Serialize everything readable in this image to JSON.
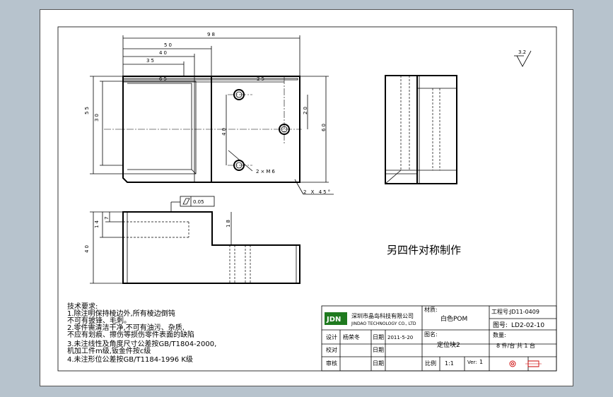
{
  "dimensions": {
    "d98": "98",
    "d50": "50",
    "d40": "40",
    "d35": "35",
    "d65": "65",
    "d25": "25",
    "d55": "55",
    "d30": "30",
    "d20": "20",
    "d60": "60",
    "d40b": "40",
    "thread": "2×M6",
    "chamfer": "2 X 45°",
    "d14": "14",
    "d7": "7",
    "d18": "18",
    "d40c": "40",
    "flatness": "0.05"
  },
  "surface_finish": "3.2",
  "note_mirror": "另四件对称制作",
  "tech_requirements": {
    "title": "技术要求:",
    "lines": [
      "1.除注明保持棱边外,所有棱边倒钝",
      "  不可有披锋、毛刺。",
      "2.零件需清洁干净,不可有油污、杂质,",
      "  不应有划痕、擦伤等损伤零件表面的缺陷",
      "3.未注线性及角度尺寸公差按GB/T1804-2000,",
      "  机加工件m级,钣金件按c级",
      "4.未注形位公差按GB/T1184-1996 K级"
    ]
  },
  "title_block": {
    "logo": "JDN",
    "company_cn": "深圳市晶岛科技有限公司",
    "company_en": "JINDAO TECHNOLOGY CO., LTD",
    "material_label": "材质:",
    "material_value": "白色POM",
    "project_label": "工程号:",
    "project_value": "JD11-0409",
    "drawing_no_label": "图号:",
    "drawing_no_value": "LD2-02-10",
    "design_label": "设计",
    "designer": "杨荣冬",
    "date_label": "日期",
    "date_value": "2011-5-20",
    "name_label": "图名:",
    "name_value": "定位块2",
    "qty_label": "数量:",
    "qty_value": "8 件/台    共 1 台",
    "check_label": "校对",
    "date2_label": "日期",
    "approve_label": "审核",
    "date3_label": "日期",
    "scale_label": "比例",
    "scale_value": "1:1",
    "ver_label": "Ver:",
    "ver_value": "1"
  }
}
